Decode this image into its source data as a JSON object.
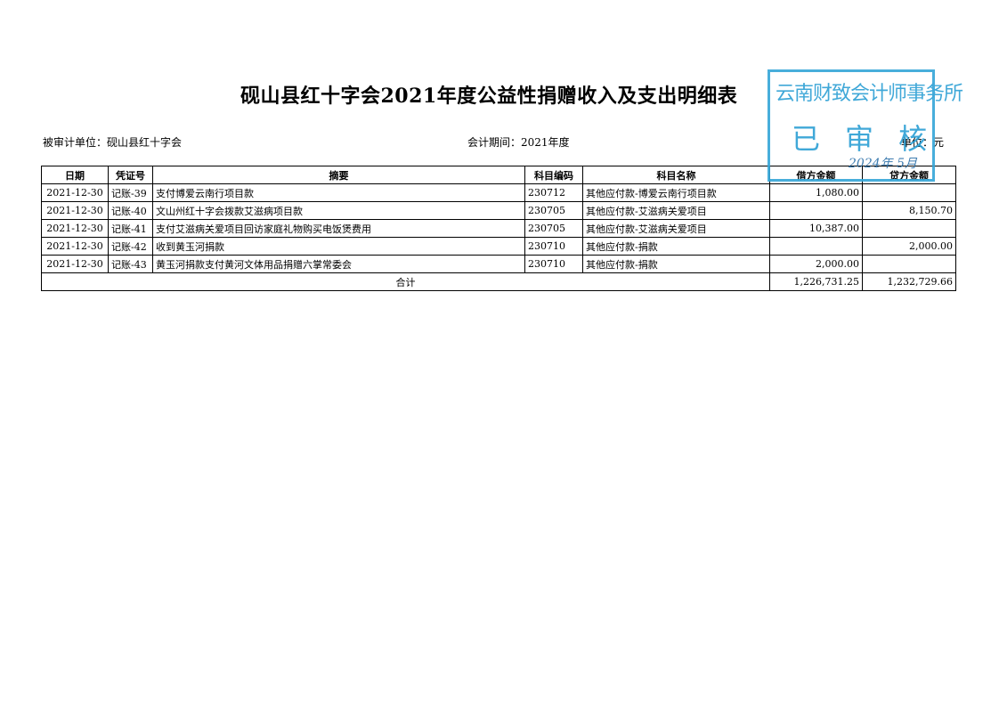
{
  "title": "砚山县红十字会2021年度公益性捐赠收入及支出明细表",
  "meta": {
    "audited_unit": "被审计单位：砚山县红十字会",
    "period": "会计期间：2021年度",
    "currency": "单位：元"
  },
  "table": {
    "headers": [
      "日期",
      "凭证号",
      "摘要",
      "科目编码",
      "科目名称",
      "借方金额",
      "贷方金额"
    ],
    "rows": [
      [
        "2021-12-30",
        "记账-39",
        "支付博爱云南行项目款",
        "230712",
        "其他应付款-博爱云南行项目款",
        "1,080.00",
        ""
      ],
      [
        "2021-12-30",
        "记账-40",
        "文山州红十字会拨款艾滋病项目款",
        "230705",
        "其他应付款-艾滋病关爱项目",
        "",
        "8,150.70"
      ],
      [
        "2021-12-30",
        "记账-41",
        "支付艾滋病关爱项目回访家庭礼物购买电饭煲费用",
        "230705",
        "其他应付款-艾滋病关爱项目",
        "10,387.00",
        ""
      ],
      [
        "2021-12-30",
        "记账-42",
        "收到黄玉河捐款",
        "230710",
        "其他应付款-捐款",
        "",
        "2,000.00"
      ],
      [
        "2021-12-30",
        "记账-43",
        "黄玉河捐款支付黄河文体用品捐赠六掌常委会",
        "230710",
        "其他应付款-捐款",
        "2,000.00",
        ""
      ]
    ],
    "total_label": "合计",
    "total_debit": "1,226,731.25",
    "total_credit": "1,232,729.66"
  },
  "stamp": {
    "org": "云南财致会计师事务所",
    "status": "已审核",
    "date": "2024年 5月"
  }
}
